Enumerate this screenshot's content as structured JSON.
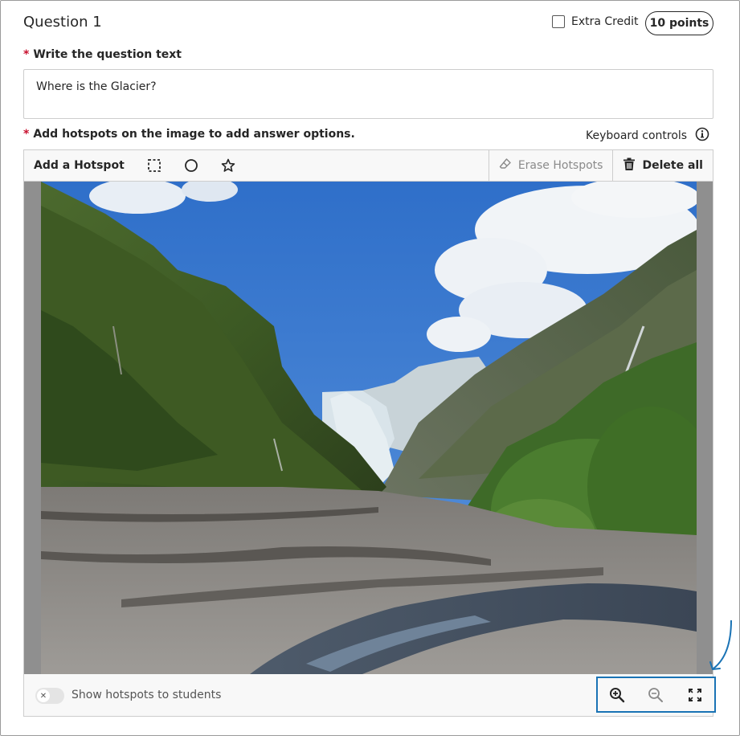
{
  "question": {
    "title": "Question 1",
    "extra_credit_label": "Extra Credit",
    "extra_credit_checked": false,
    "points": "10 points"
  },
  "question_text": {
    "required_mark": "*",
    "label": "Write the question text",
    "value": "Where is the Glacier?"
  },
  "hotspots": {
    "required_mark": "*",
    "label": "Add hotspots on the image to add answer options.",
    "keyboard_controls_label": "Keyboard controls"
  },
  "toolbar": {
    "add_hotspot_label": "Add a Hotspot",
    "tools": [
      "rectangle-select-icon",
      "circle-icon",
      "polygon-star-icon"
    ],
    "erase_label": "Erase Hotspots",
    "delete_all_label": "Delete all"
  },
  "footer": {
    "show_hotspots_label": "Show hotspots to students",
    "show_hotspots_on": false,
    "zoom_in_icon": "zoom-in-icon",
    "zoom_out_icon": "zoom-out-icon",
    "fullscreen_icon": "fullscreen-icon"
  },
  "colors": {
    "required": "#c8102e",
    "highlight": "#1a73b5",
    "text": "#262626"
  }
}
